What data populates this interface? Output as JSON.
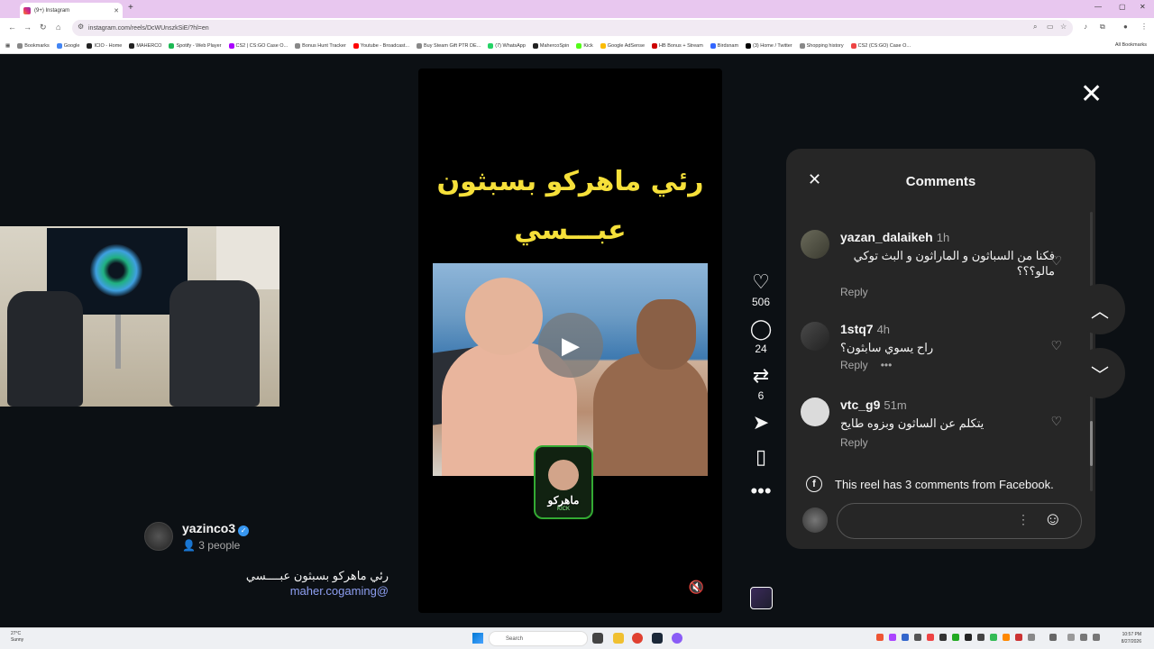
{
  "browser": {
    "tab_title": "(9+) Instagram",
    "url": "instagram.com/reels/DcWUnszkSiE/?hl=en",
    "new_tab": "+",
    "bookmarks": [
      "Bookmarks",
      "Google",
      "ICIO - Home",
      "MAHERCO",
      "Spotify - Web Player",
      "CS2 | CS:GO Case O...",
      "Bonus Hunt Tracker",
      "Youtube - Broadcast...",
      "Buy Steam Gift PTR DE...",
      "(7) WhatsApp",
      "MahercoSpin",
      "Kick",
      "Google AdSense",
      "HB Bonus + Stream",
      "Birdsnam",
      "(3) Home / Twitter",
      "Shopping history",
      "CS2 (CS:GO) Case O..."
    ],
    "all_bookmarks": "All Bookmarks"
  },
  "reel": {
    "overlay_line1": "رئي ماهركو بسبثون",
    "overlay_line2": "عبـــسي",
    "logo_name": "ماهركو",
    "logo_sub": "KICK"
  },
  "author": {
    "username": "yazinco3",
    "people": "3 people",
    "caption": "رئي ماهركو بسبثون عبــــسي",
    "mention": "maher.cogaming@"
  },
  "actions": {
    "likes": "506",
    "comments": "24",
    "reposts": "6"
  },
  "comments_panel": {
    "title": "Comments",
    "items": [
      {
        "user": "yazan_dalaikeh",
        "time": "1h",
        "text": "فكنا من السباثون و الماراثون و البث توكي مالو؟؟؟",
        "reply": "Reply"
      },
      {
        "user": "1stq7",
        "time": "4h",
        "text": "راح يسوي سابثون؟",
        "reply": "Reply",
        "more": "•••"
      },
      {
        "user": "vtc_g9",
        "time": "51m",
        "text": "يتكلم عن الساثون وبزوه طايح",
        "reply": "Reply"
      }
    ],
    "facebook_note": "This reel has 3 comments from Facebook.",
    "input_placeholder": ""
  },
  "taskbar": {
    "weather_temp": "27°C",
    "weather_desc": "Sunny",
    "search": "Search",
    "time": "10:57 PM",
    "date": "8/27/2026"
  }
}
